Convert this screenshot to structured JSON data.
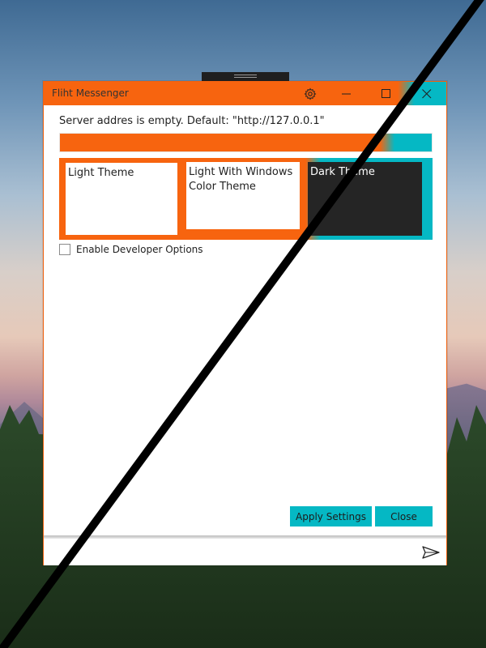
{
  "window": {
    "title": "Fliht Messenger"
  },
  "settings": {
    "server_message": "Server addres is empty. Default: \"http://127.0.0.1\"",
    "server_value": "",
    "themes": [
      {
        "label": "Light Theme"
      },
      {
        "label": "Light With Windows Color Theme"
      },
      {
        "label": "Dark Theme"
      }
    ],
    "developer_options_label": "Enable Developer Options",
    "developer_options_checked": false,
    "apply_label": "Apply Settings",
    "close_label": "Close"
  },
  "message_bar": {
    "value": ""
  },
  "colors": {
    "accent": "#f7640f",
    "windows_accent": "#05b8c4",
    "dark_theme_bg": "#252525"
  },
  "icons": {
    "settings": "gear-icon",
    "minimize": "minimize-icon",
    "maximize": "maximize-icon",
    "close": "close-icon",
    "send": "send-icon"
  }
}
